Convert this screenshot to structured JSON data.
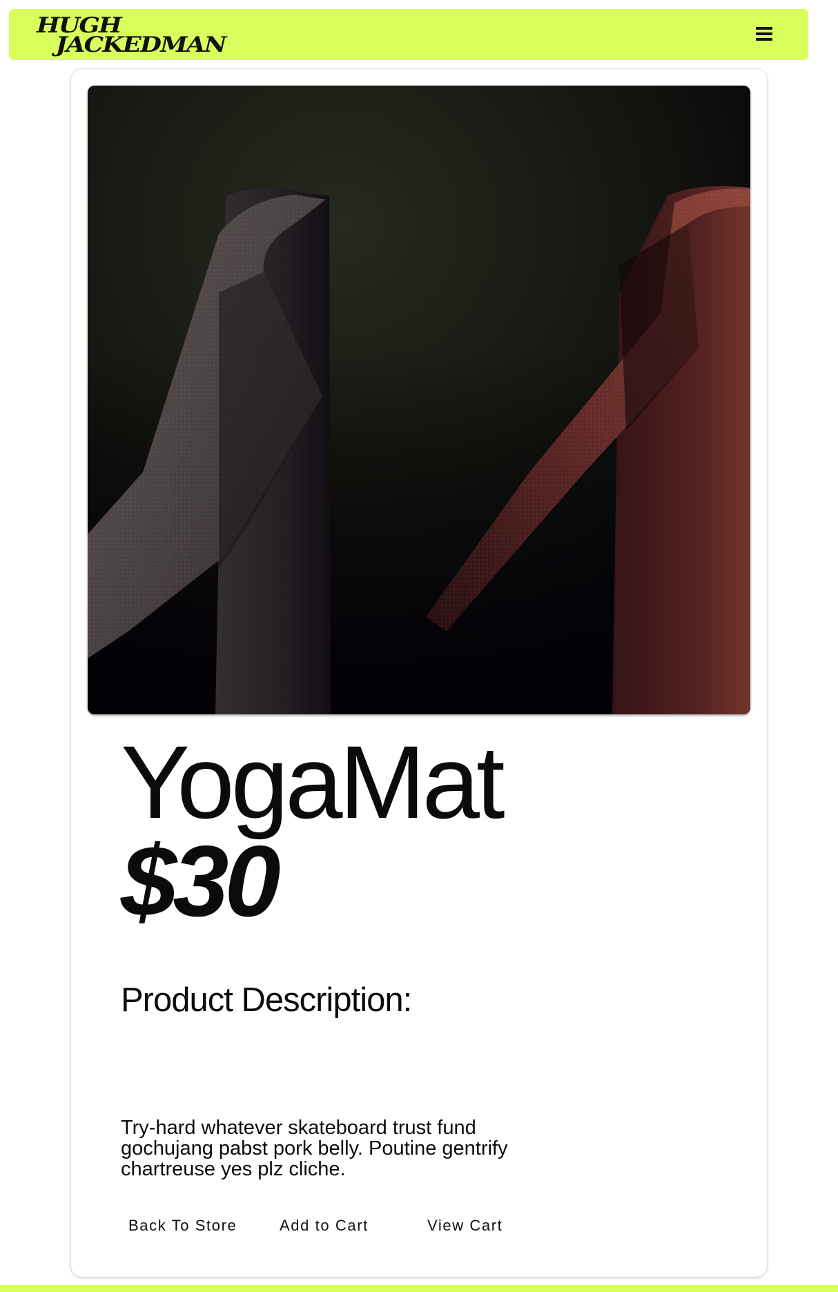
{
  "colors": {
    "accent": "#d8ff5c",
    "text": "#0b0b0b",
    "card_background": "#ffffff"
  },
  "navbar": {
    "logo_line1": "HUGH",
    "logo_line2": "JACKEDMAN",
    "menu_icon": "hamburger-menu-icon"
  },
  "product": {
    "image_subject": "Two rolled yoga mats standing upright, one grey and one red",
    "name": "YogaMat",
    "price": "$30",
    "description_heading": "Product Description:",
    "description": "Try-hard whatever skateboard trust fund gochujang pabst pork belly. Poutine gentrify chartreuse yes plz cliche."
  },
  "actions": {
    "back_label": "Back To Store",
    "add_label": "Add to Cart",
    "view_label": "View Cart"
  }
}
